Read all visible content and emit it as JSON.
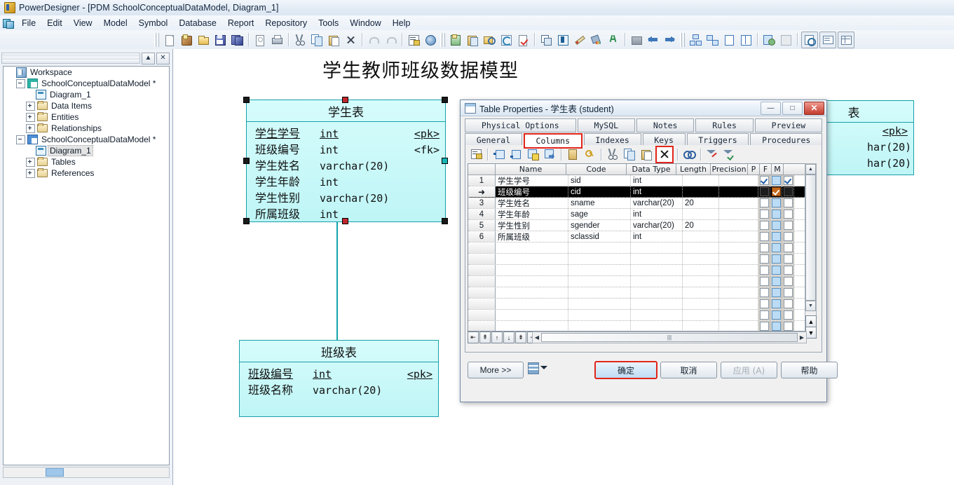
{
  "window": {
    "title": "PowerDesigner - [PDM SchoolConceptualDataModel, Diagram_1]",
    "app_icon": "powerdesigner-icon"
  },
  "menubar": {
    "items": [
      "File",
      "Edit",
      "View",
      "Model",
      "Symbol",
      "Database",
      "Report",
      "Repository",
      "Tools",
      "Window",
      "Help"
    ]
  },
  "toolbar": {
    "groups": [
      {
        "icons": [
          "new-icon",
          "new-model-icon",
          "open-icon",
          "save-icon",
          "save-all-icon"
        ]
      },
      {
        "icons": [
          "print-preview-icon",
          "print-icon"
        ]
      },
      {
        "icons": [
          "cut-icon",
          "copy-icon",
          "paste-icon",
          "delete-icon"
        ]
      },
      {
        "icons": [
          "undo-icon",
          "redo-icon"
        ]
      },
      {
        "icons": [
          "properties-icon",
          "browser-icon"
        ]
      },
      {
        "icons": [
          "new-object-icon",
          "paste-object-icon",
          "find-object-icon",
          "refresh-icon",
          "check-model-icon"
        ]
      },
      {
        "icons": [
          "shape-icon",
          "text-box-icon",
          "pencil-icon",
          "fill-color-icon",
          "font-color-icon"
        ]
      },
      {
        "icons": [
          "folder-icon",
          "previous-icon",
          "next-icon"
        ]
      },
      {
        "icons": [
          "hierarchy-icon",
          "dependencies-icon",
          "page-icon",
          "columns-icon"
        ]
      },
      {
        "icons": [
          "generate-icon",
          "reverse-icon"
        ]
      },
      {
        "icons": [
          "zoom-icon",
          "comment-icon",
          "grid-icon"
        ]
      }
    ]
  },
  "browser": {
    "panel_buttons": [
      "minimize-panel-button",
      "close-panel-button"
    ],
    "tree": [
      {
        "label": "Workspace",
        "depth": 0,
        "icon": "workspace-icon",
        "expander": "none",
        "selected": false
      },
      {
        "label": "SchoolConceptualDataModel *",
        "depth": 1,
        "icon": "cdm-model-icon",
        "expander": "minus",
        "selected": false
      },
      {
        "label": "Diagram_1",
        "depth": 2,
        "icon": "cdm-diagram-icon",
        "expander": "none",
        "selected": false
      },
      {
        "label": "Data Items",
        "depth": 2,
        "icon": "folder-icon",
        "expander": "plus",
        "selected": false
      },
      {
        "label": "Entities",
        "depth": 2,
        "icon": "folder-icon",
        "expander": "plus",
        "selected": false
      },
      {
        "label": "Relationships",
        "depth": 2,
        "icon": "folder-icon",
        "expander": "plus",
        "selected": false
      },
      {
        "label": "SchoolConceptualDataModel *",
        "depth": 1,
        "icon": "pdm-model-icon",
        "expander": "minus",
        "selected": false
      },
      {
        "label": "Diagram_1",
        "depth": 2,
        "icon": "pdm-diagram-icon",
        "expander": "none",
        "selected": true
      },
      {
        "label": "Tables",
        "depth": 2,
        "icon": "folder-icon",
        "expander": "plus",
        "selected": false
      },
      {
        "label": "References",
        "depth": 2,
        "icon": "folder-icon",
        "expander": "plus",
        "selected": false
      }
    ]
  },
  "canvas": {
    "title": "学生教师班级数据模型",
    "entities": [
      {
        "name": "学生表",
        "selected": true,
        "columns": [
          {
            "name": "学生学号",
            "type": "int",
            "key": "<pk>",
            "underline": true
          },
          {
            "name": "班级编号",
            "type": "int",
            "key": "<fk>",
            "underline": false
          },
          {
            "name": "学生姓名",
            "type": "varchar(20)",
            "key": "",
            "underline": false
          },
          {
            "name": "学生年龄",
            "type": "int",
            "key": "",
            "underline": false
          },
          {
            "name": "学生性别",
            "type": "varchar(20)",
            "key": "",
            "underline": false
          },
          {
            "name": "所属班级",
            "type": "int",
            "key": "",
            "underline": false
          }
        ]
      },
      {
        "name": "班级表",
        "selected": false,
        "columns": [
          {
            "name": "班级编号",
            "type": "int",
            "key": "<pk>",
            "underline": true
          },
          {
            "name": "班级名称",
            "type": "varchar(20)",
            "key": "",
            "underline": false
          }
        ]
      }
    ],
    "partial_entity": {
      "name_fragment": "表",
      "rows": [
        {
          "key": "<pk>",
          "type_fragment": ""
        },
        {
          "key": "",
          "type_fragment": "har(20)"
        },
        {
          "key": "",
          "type_fragment": "har(20)"
        }
      ]
    }
  },
  "dialog": {
    "title": "Table Properties - 学生表 (student)",
    "icon": "table-icon",
    "window_buttons": {
      "minimize": "—",
      "maximize": "□",
      "close": "✕"
    },
    "tabs_row1": [
      "Physical Options",
      "MySQL",
      "Notes",
      "Rules",
      "Preview"
    ],
    "tabs_row2": [
      "General",
      "Columns",
      "Indexes",
      "Keys",
      "Triggers",
      "Procedures"
    ],
    "active_tab": "Columns",
    "toolbar_icons": [
      "properties-icon",
      "insert-row-icon",
      "add-row-icon",
      "add-new-icon",
      "add-existing-icon",
      "create-object-icon",
      "key-icon",
      "cut-icon",
      "copy-icon",
      "paste-icon",
      "delete-icon",
      "find-icon",
      "customize-columns-icon",
      "apply-filter-icon"
    ],
    "highlighted_toolbar_icon": "delete-icon",
    "grid": {
      "headers": [
        "",
        "Name",
        "Code",
        "Data Type",
        "Length",
        "Precision",
        "P",
        "F",
        "M"
      ],
      "rows": [
        {
          "num": "1",
          "name": "学生学号",
          "code": "sid",
          "data_type": "int",
          "length": "",
          "precision": "",
          "p": true,
          "f": false,
          "m": true,
          "selected": false
        },
        {
          "num": "➜",
          "name": "班级编号",
          "code": "cid",
          "data_type": "int",
          "length": "",
          "precision": "",
          "p": false,
          "f": true,
          "m": false,
          "selected": true
        },
        {
          "num": "3",
          "name": "学生姓名",
          "code": "sname",
          "data_type": "varchar(20)",
          "length": "20",
          "precision": "",
          "p": false,
          "f": false,
          "m": false,
          "selected": false
        },
        {
          "num": "4",
          "name": "学生年龄",
          "code": "sage",
          "data_type": "int",
          "length": "",
          "precision": "",
          "p": false,
          "f": false,
          "m": false,
          "selected": false
        },
        {
          "num": "5",
          "name": "学生性别",
          "code": "sgender",
          "data_type": "varchar(20)",
          "length": "20",
          "precision": "",
          "p": false,
          "f": false,
          "m": false,
          "selected": false
        },
        {
          "num": "6",
          "name": "所属班级",
          "code": "sclassid",
          "data_type": "int",
          "length": "",
          "precision": "",
          "p": false,
          "f": false,
          "m": false,
          "selected": false
        }
      ],
      "empty_row_count": 11,
      "nav_buttons": [
        "first-row-button",
        "prev-page-button",
        "prev-row-button",
        "next-row-button",
        "next-page-button",
        "last-row-button"
      ]
    },
    "footer": {
      "more_label": "More >>",
      "list_icon": "list-options-icon",
      "dropdown_icon": "chevron-down-icon",
      "ok_label": "确定",
      "cancel_label": "取消",
      "apply_label": "应用 (A)",
      "help_label": "帮助",
      "apply_disabled": true
    }
  },
  "colors": {
    "entity_fill": "#c9f7f8",
    "entity_border": "#17a0a8",
    "connector": "#12a5ad",
    "highlight_red": "#e2241a",
    "selection_black": "#000000"
  }
}
